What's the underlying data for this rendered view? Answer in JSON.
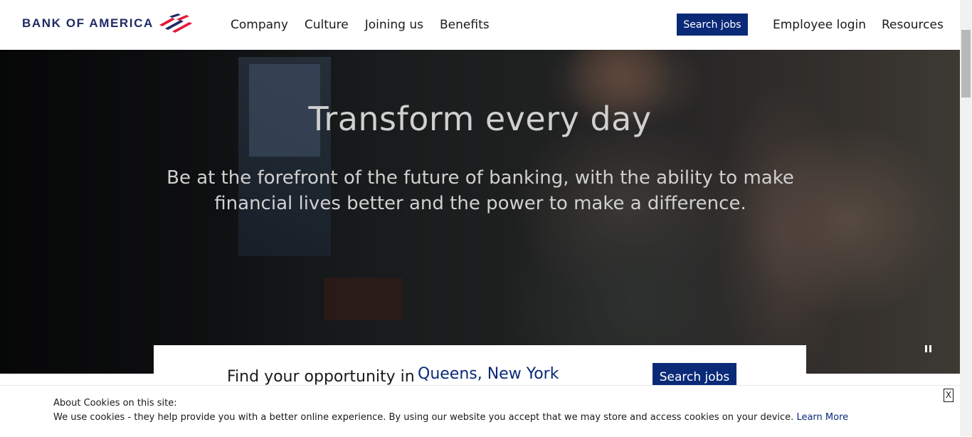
{
  "header": {
    "logo_text": "BANK OF AMERICA",
    "nav": [
      "Company",
      "Culture",
      "Joining us",
      "Benefits"
    ],
    "search_button": "Search jobs",
    "employee_login": "Employee login",
    "resources": "Resources"
  },
  "hero": {
    "title": "Transform every day",
    "subtitle": "Be at the forefront of the future of banking, with the ability to make financial lives better and the power to make a difference."
  },
  "find": {
    "label": "Find your opportunity in",
    "location": "Queens, New York",
    "button": "Search jobs"
  },
  "cookie": {
    "title": "About Cookies on this site:",
    "text": "We use cookies - they help provide you with a better online experience. By using our website you accept that we may store and access cookies on your device.",
    "link": "Learn More",
    "close": "X"
  },
  "colors": {
    "brand_navy": "#0a2a78",
    "logo_blue": "#1f2a64",
    "logo_red": "#e31837"
  }
}
